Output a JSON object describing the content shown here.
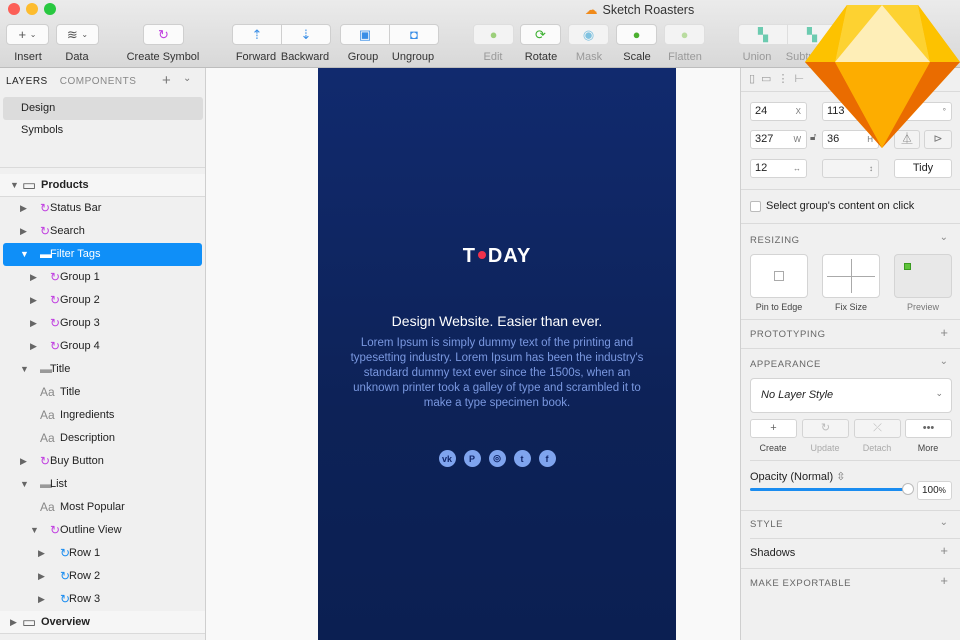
{
  "window": {
    "title": "Sketch Roasters"
  },
  "toolbar": {
    "insert": "Insert",
    "data": "Data",
    "create_symbol": "Create Symbol",
    "forward": "Forward",
    "backward": "Backward",
    "group": "Group",
    "ungroup": "Ungroup",
    "edit": "Edit",
    "rotate": "Rotate",
    "mask": "Mask",
    "scale": "Scale",
    "flatten": "Flatten",
    "union": "Union",
    "subtract": "Subtra"
  },
  "sidebar": {
    "tab_layers": "LAYERS",
    "tab_components": "COMPONENTS",
    "pages": [
      "Design",
      "Symbols"
    ],
    "layers": [
      {
        "label": "Products",
        "level": 0,
        "type": "artboard",
        "expanded": true
      },
      {
        "label": "Status Bar",
        "level": 1,
        "type": "symbol",
        "expanded": false
      },
      {
        "label": "Search",
        "level": 1,
        "type": "symbol",
        "expanded": false
      },
      {
        "label": "Filter Tags",
        "level": 1,
        "type": "folder",
        "expanded": true,
        "selected": true
      },
      {
        "label": "Group 1",
        "level": 2,
        "type": "symbol",
        "expanded": false
      },
      {
        "label": "Group 2",
        "level": 2,
        "type": "symbol",
        "expanded": false
      },
      {
        "label": "Group 3",
        "level": 2,
        "type": "symbol",
        "expanded": false
      },
      {
        "label": "Group 4",
        "level": 2,
        "type": "symbol",
        "expanded": false
      },
      {
        "label": "Title",
        "level": 1,
        "type": "folder",
        "expanded": true
      },
      {
        "label": "Title",
        "level": 2,
        "type": "text"
      },
      {
        "label": "Ingredients",
        "level": 2,
        "type": "text"
      },
      {
        "label": "Description",
        "level": 2,
        "type": "text"
      },
      {
        "label": "Buy Button",
        "level": 1,
        "type": "symbol",
        "expanded": false
      },
      {
        "label": "List",
        "level": 1,
        "type": "folder",
        "expanded": true
      },
      {
        "label": "Most Popular",
        "level": 2,
        "type": "text"
      },
      {
        "label": "Outline View",
        "level": 2,
        "type": "symbol",
        "expanded": true
      },
      {
        "label": "Row 1",
        "level": 3,
        "type": "symbol-blue",
        "expanded": false
      },
      {
        "label": "Row 2",
        "level": 3,
        "type": "symbol-blue",
        "expanded": false
      },
      {
        "label": "Row 3",
        "level": 3,
        "type": "symbol-blue",
        "expanded": false
      },
      {
        "label": "Overview",
        "level": 0,
        "type": "artboard",
        "expanded": false
      }
    ]
  },
  "artboard": {
    "logo_left": "T",
    "logo_right": "DAY",
    "headline": "Design Website. Easier than ever.",
    "body": "Lorem Ipsum is simply dummy text of the printing and typesetting industry. Lorem Ipsum has been the industry's standard dummy text ever since the 1500s, when an unknown printer took a galley of type and scrambled it to make a type specimen book.",
    "social": [
      {
        "icon": "vk-icon",
        "glyph": "vk"
      },
      {
        "icon": "pinterest-icon",
        "glyph": "P"
      },
      {
        "icon": "instagram-icon",
        "glyph": "◎"
      },
      {
        "icon": "twitter-icon",
        "glyph": "t"
      },
      {
        "icon": "facebook-icon",
        "glyph": "f"
      }
    ]
  },
  "inspector": {
    "x": "24",
    "x_suffix": "X",
    "y": "113",
    "rotation_suffix": "°",
    "w": "327",
    "w_suffix": "W",
    "h": "36",
    "h_suffix": "H",
    "spacing": "12",
    "spacing_suffix": "↔",
    "tidy": "Tidy",
    "select_group_content": "Select group's content on click",
    "resizing": "RESIZING",
    "pin_to_edge": "Pin to Edge",
    "fix_size": "Fix Size",
    "preview": "Preview",
    "prototyping": "PROTOTYPING",
    "appearance": "APPEARANCE",
    "layer_style": "No Layer Style",
    "create": "Create",
    "update": "Update",
    "detach": "Detach",
    "more": "More",
    "opacity_label": "Opacity (Normal)",
    "opacity_value": "100",
    "opacity_unit": "%",
    "opacity_fraction": 1.0,
    "style": "STYLE",
    "shadows": "Shadows",
    "make_exportable": "MAKE EXPORTABLE"
  },
  "colors": {
    "accent": "#0f8ff8",
    "artboard": "#0d2257",
    "logo_dot": "#f0314b",
    "symbol": "#c03fe0"
  }
}
